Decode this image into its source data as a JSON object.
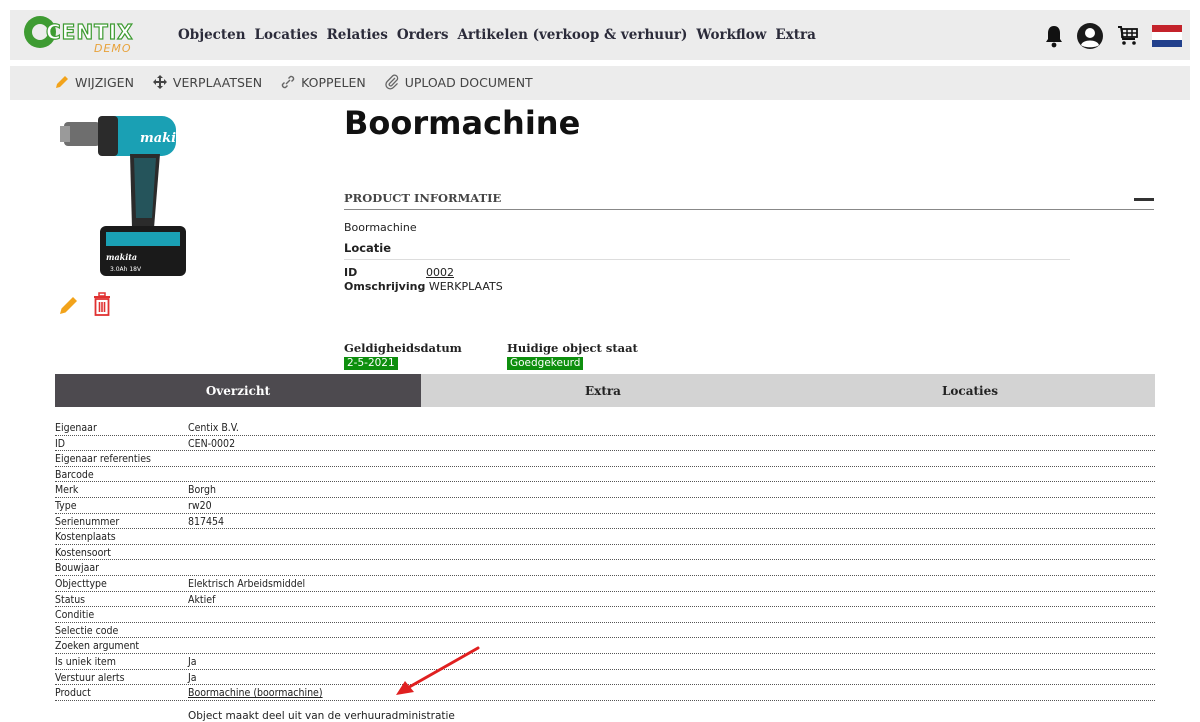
{
  "brand": {
    "name": "CENTIX",
    "sub": "DEMO"
  },
  "nav": {
    "items": [
      "Objecten",
      "Locaties",
      "Relaties",
      "Orders",
      "Artikelen (verkoop & verhuur)",
      "Workflow",
      "Extra"
    ]
  },
  "icons": {
    "notifications": "bell-icon",
    "account": "user-icon",
    "cart": "cart-icon",
    "language": "flag-nl-icon"
  },
  "actions": {
    "edit": "WIJZIGEN",
    "move": "VERPLAATSEN",
    "link": "KOPPELEN",
    "upload": "UPLOAD DOCUMENT"
  },
  "product": {
    "title": "Boormachine",
    "section_title": "PRODUCT INFORMATIE",
    "name": "Boormachine",
    "location_heading": "Locatie",
    "id_label": "ID",
    "id_value": "0002",
    "description_label": "Omschrijving",
    "description_value": "WERKPLAATS",
    "validity_label": "Geldigheidsdatum",
    "validity_value": "2-5-2021",
    "state_label": "Huidige object staat",
    "state_value": "Goedgekeurd"
  },
  "tabs": [
    "Overzicht",
    "Extra",
    "Locaties"
  ],
  "properties": [
    {
      "key": "Eigenaar",
      "value": "Centix B.V."
    },
    {
      "key": "ID",
      "value": "CEN-0002"
    },
    {
      "key": "Eigenaar referenties",
      "value": ""
    },
    {
      "key": "Barcode",
      "value": ""
    },
    {
      "key": "Merk",
      "value": "Borgh"
    },
    {
      "key": "Type",
      "value": "rw20"
    },
    {
      "key": "Serienummer",
      "value": "817454"
    },
    {
      "key": "Kostenplaats",
      "value": ""
    },
    {
      "key": "Kostensoort",
      "value": ""
    },
    {
      "key": "Bouwjaar",
      "value": ""
    },
    {
      "key": "Objecttype",
      "value": "Elektrisch Arbeidsmiddel"
    },
    {
      "key": "Status",
      "value": "Aktief"
    },
    {
      "key": "Conditie",
      "value": ""
    },
    {
      "key": "Selectie code",
      "value": ""
    },
    {
      "key": "Zoeken argument",
      "value": ""
    },
    {
      "key": "Is uniek item",
      "value": "Ja"
    },
    {
      "key": "Verstuur alerts",
      "value": "Ja"
    },
    {
      "key": "Product",
      "value": "Boormachine (boormachine)"
    }
  ],
  "product_note": "Object maakt deel uit van de verhuuradministratie",
  "colors": {
    "accent_green": "#0e8f0e",
    "tab_active": "#4d4a4f",
    "edit_orange": "#f2a31b",
    "delete_red": "#e03131",
    "arrow_red": "#e02020"
  }
}
